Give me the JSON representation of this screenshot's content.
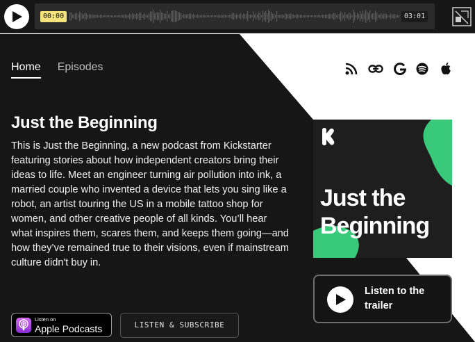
{
  "player": {
    "current_time": "00:00",
    "total_time": "03:01",
    "accent_color": "#f4e27a"
  },
  "nav": {
    "items": [
      {
        "label": "Home",
        "active": true
      },
      {
        "label": "Episodes",
        "active": false
      }
    ]
  },
  "social": {
    "icons": [
      "rss-icon",
      "link-icon",
      "google-podcasts-icon",
      "spotify-icon",
      "apple-icon"
    ]
  },
  "podcast": {
    "title": "Just the Beginning",
    "description": "This is Just the Beginning, a new podcast from Kickstarter featuring stories about how independent creators bring their ideas to life.   Meet an engineer turning air pollution into ink, a married couple who invented a device that lets you sing like a robot, an artist touring the US in a mobile tattoo shop for women, and other creative people of all kinds. You’ll hear what inspires them, scares them, and keeps them going—and how they’ve remained true to their visions, even if mainstream culture didn't buy in."
  },
  "cover": {
    "title_line1": "Just the",
    "title_line2": "Beginning",
    "brand_mark": "K",
    "accent_color": "#38c97a"
  },
  "trailer": {
    "label": "Listen to the trailer"
  },
  "apple_badge": {
    "small_text": "Listen on",
    "big_text": "Apple Podcasts"
  },
  "subscribe": {
    "label": "LISTEN & SUBSCRIBE"
  },
  "colors": {
    "background_dark": "#161616",
    "background_light": "#ffffff"
  }
}
